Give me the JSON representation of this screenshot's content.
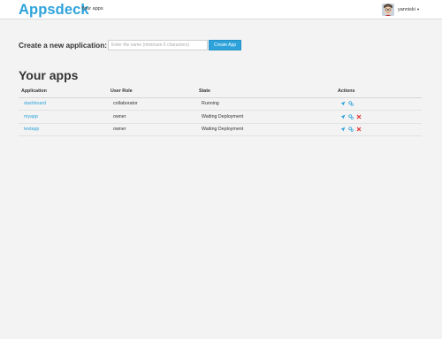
{
  "topbar": {
    "brand": "Appsdeck",
    "nav_link": "Your apps",
    "username": "yanniski",
    "caret": "▾"
  },
  "create": {
    "label": "Create a new application:",
    "placeholder": "Enter the name (minimum 6 characters)",
    "value": "",
    "button_label": "Create App"
  },
  "section_title": "Your apps",
  "table": {
    "headers": [
      "Application",
      "User Role",
      "State",
      "Actions"
    ],
    "rows": [
      {
        "name": "dashboard",
        "role": "collaborator",
        "state": "Running",
        "actions": [
          "deploy-icon",
          "settings-icon"
        ]
      },
      {
        "name": "myapp",
        "role": "owner",
        "state": "Waiting Deployment",
        "actions": [
          "deploy-icon",
          "settings-icon",
          "delete-icon"
        ]
      },
      {
        "name": "testapp",
        "role": "owner",
        "state": "Waiting Deployment",
        "actions": [
          "deploy-icon",
          "settings-icon",
          "delete-icon"
        ]
      }
    ]
  },
  "colors": {
    "brand": "#2ea3db",
    "link": "#2ea3db",
    "delete": "#e03232",
    "background": "#f3f3f3"
  }
}
